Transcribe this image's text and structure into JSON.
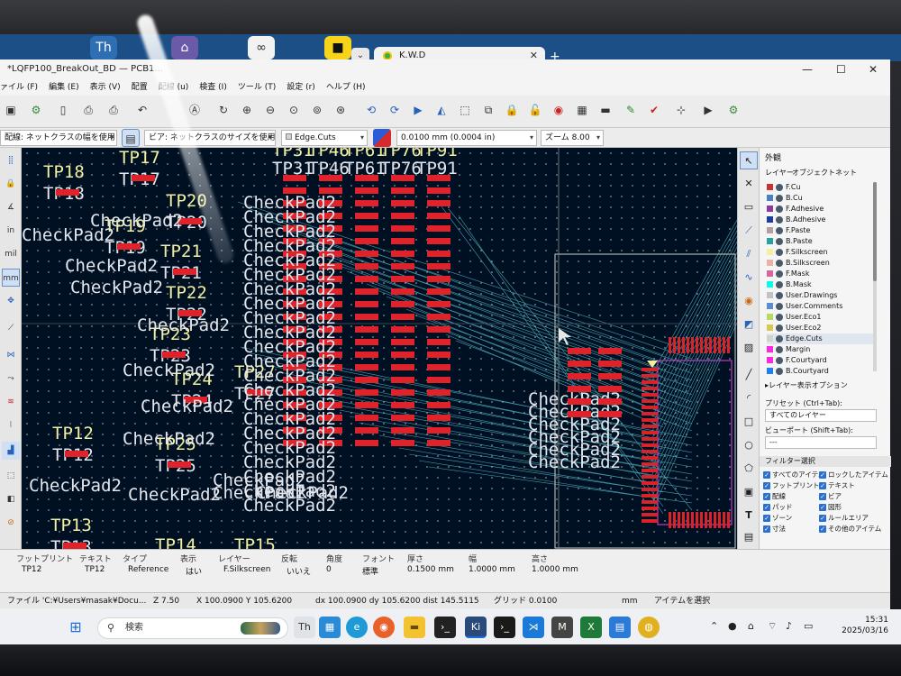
{
  "os": {
    "browser_tab": {
      "title": "K.W.D"
    },
    "taskbar": {
      "search_placeholder": "検索",
      "time": "15:31",
      "date": "2025/03/16"
    }
  },
  "window": {
    "title": "*LQFP100_BreakOut_BD — PCB1...",
    "menu": [
      "ァイル (F)",
      "編集 (E)",
      "表示 (V)",
      "配置",
      "配線 (u)",
      "検査 (I)",
      "ツール (T)",
      "設定 (r)",
      "ヘルプ (H)"
    ],
    "options": {
      "track_width": "配線: ネットクラスの幅を使用",
      "via_size": "ビア: ネットクラスのサイズを使用",
      "layer": "Edge.Cuts",
      "grid": "0.0100 mm (0.0004 in)",
      "zoom": "ズーム 8.00"
    },
    "left_toolbar_labels": [
      "in",
      "mil",
      "mm"
    ]
  },
  "panel": {
    "title": "外観",
    "tabs": [
      "レイヤー",
      "オブジェクト",
      "ネット"
    ],
    "layers": [
      {
        "name": "F.Cu",
        "color": "#c83434"
      },
      {
        "name": "B.Cu",
        "color": "#4d7fc4"
      },
      {
        "name": "F.Adhesive",
        "color": "#8a3aa0"
      },
      {
        "name": "B.Adhesive",
        "color": "#1e3da0"
      },
      {
        "name": "F.Paste",
        "color": "#b4a0a0"
      },
      {
        "name": "B.Paste",
        "color": "#2aa0a0"
      },
      {
        "name": "F.Silkscreen",
        "color": "#f2f0a0"
      },
      {
        "name": "B.Silkscreen",
        "color": "#e8b2a7"
      },
      {
        "name": "F.Mask",
        "color": "#d864a0"
      },
      {
        "name": "B.Mask",
        "color": "#02ffee"
      },
      {
        "name": "User.Drawings",
        "color": "#c2c2c2"
      },
      {
        "name": "User.Comments",
        "color": "#598ed1"
      },
      {
        "name": "User.Eco1",
        "color": "#b4db62"
      },
      {
        "name": "User.Eco2",
        "color": "#d8c852"
      },
      {
        "name": "Edge.Cuts",
        "color": "#d0d2cd"
      },
      {
        "name": "Margin",
        "color": "#ff26e2"
      },
      {
        "name": "F.Courtyard",
        "color": "#ff26e2"
      },
      {
        "name": "B.Courtyard",
        "color": "#1f7ff0"
      }
    ],
    "layer_options": "▸レイヤー表示オプション",
    "preset_label": "プリセット (Ctrl+Tab):",
    "preset_value": "すべてのレイヤー",
    "viewport_label": "ビューポート (Shift+Tab):",
    "viewport_value": "---",
    "filter_title": "フィルター選択",
    "filters_left": [
      "すべてのアイテム",
      "フットプリント",
      "配線",
      "パッド",
      "ゾーン",
      "寸法"
    ],
    "filters_right": [
      "ロックしたアイテム",
      "テキスト",
      "ビア",
      "図形",
      "ルールエリア",
      "その他のアイテム"
    ]
  },
  "message_panel": {
    "headers": [
      "フットプリント",
      "テキスト",
      "タイプ",
      "表示",
      "レイヤー",
      "反転",
      "角度",
      "フォント",
      "厚さ",
      "幅",
      "高さ"
    ],
    "values": [
      "TP12",
      "TP12",
      "Reference",
      "はい",
      "F.Silkscreen",
      "いいえ",
      "0",
      "標準",
      "0.1500 mm",
      "1.0000 mm",
      "1.0000 mm"
    ]
  },
  "status": {
    "file": "ファイル 'C:¥Users¥masak¥Docu...",
    "z": "Z 7.50",
    "xy": "X 100.0900 Y 105.6200",
    "delta": "dx 100.0900 dy 105.6200 dist 145.5115",
    "grid": "グリッド 0.0100",
    "unit": "mm",
    "item": "アイテムを選択"
  },
  "canvas": {
    "refs": [
      "TP17",
      "TP18",
      "TP20",
      "TP19",
      "TP21",
      "TP22",
      "TP23",
      "TP24",
      "TP12",
      "TP25",
      "TP13",
      "TP14",
      "TP15",
      "TP27",
      "TP31",
      "TP46",
      "TP61",
      "TP76",
      "TP91"
    ],
    "value_text": "CheckPad2"
  }
}
